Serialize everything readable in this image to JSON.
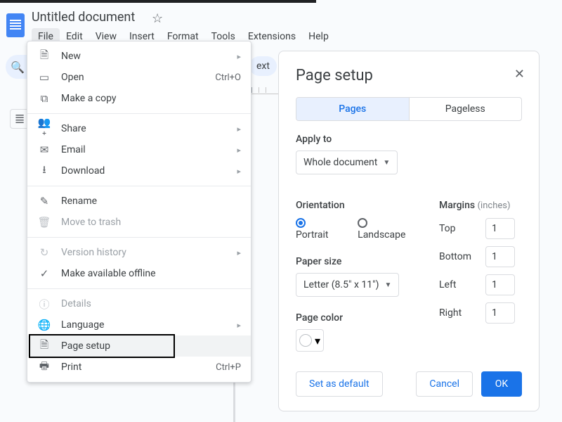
{
  "doc": {
    "title": "Untitled document"
  },
  "menubar": [
    "File",
    "Edit",
    "View",
    "Insert",
    "Format",
    "Tools",
    "Extensions",
    "Help"
  ],
  "toolbar_fragment": "ext",
  "file_menu": {
    "items": [
      {
        "icon": "🗎",
        "label": "New",
        "chev": true
      },
      {
        "icon": "▭",
        "label": "Open",
        "shortcut": "Ctrl+O"
      },
      {
        "icon": "⧉",
        "label": "Make a copy"
      }
    ],
    "group2": [
      {
        "icon": "👥⁺",
        "label": "Share",
        "chev": true
      },
      {
        "icon": "✉",
        "label": "Email",
        "chev": true
      },
      {
        "icon": "⭳",
        "label": "Download",
        "chev": true
      }
    ],
    "group3": [
      {
        "icon": "✎",
        "label": "Rename"
      },
      {
        "icon": "🗑",
        "label": "Move to trash",
        "disabled": true
      }
    ],
    "group4": [
      {
        "icon": "↻",
        "label": "Version history",
        "chev": true,
        "disabled": true
      },
      {
        "icon": "✓",
        "label": "Make available offline"
      }
    ],
    "group5": [
      {
        "icon": "ⓘ",
        "label": "Details",
        "disabled": true
      },
      {
        "icon": "🌐",
        "label": "Language",
        "chev": true
      },
      {
        "icon": "🗎",
        "label": "Page setup",
        "highlight": true
      },
      {
        "icon": "🖶",
        "label": "Print",
        "shortcut": "Ctrl+P"
      }
    ]
  },
  "dialog": {
    "title": "Page setup",
    "tabs": {
      "pages": "Pages",
      "pageless": "Pageless"
    },
    "apply_to": {
      "label": "Apply to",
      "value": "Whole document"
    },
    "orientation": {
      "label": "Orientation",
      "portrait": "Portrait",
      "landscape": "Landscape"
    },
    "paper_size": {
      "label": "Paper size",
      "value": "Letter (8.5\" x 11\")"
    },
    "page_color": {
      "label": "Page color"
    },
    "margins": {
      "label": "Margins",
      "unit": "(inches)",
      "top": {
        "label": "Top",
        "value": "1"
      },
      "bottom": {
        "label": "Bottom",
        "value": "1"
      },
      "left": {
        "label": "Left",
        "value": "1"
      },
      "right": {
        "label": "Right",
        "value": "1"
      }
    },
    "actions": {
      "default": "Set as default",
      "cancel": "Cancel",
      "ok": "OK"
    }
  }
}
